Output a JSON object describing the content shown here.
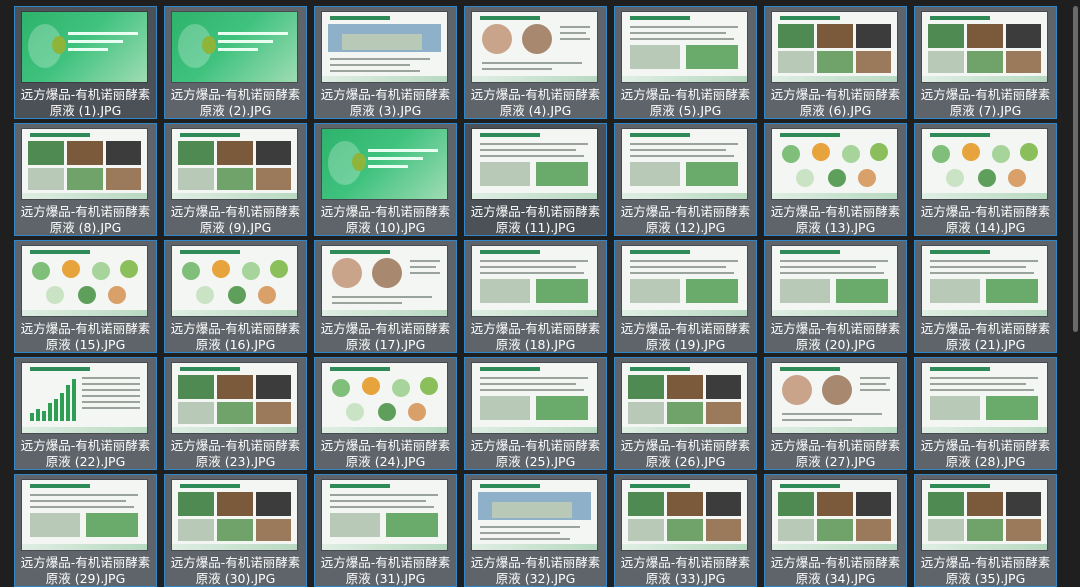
{
  "files": [
    {
      "name": "远方爆品-有机诺丽酵素\n原液 (1).JPG",
      "style": "green"
    },
    {
      "name": "远方爆品-有机诺丽酵素\n原液 (2).JPG",
      "style": "green"
    },
    {
      "name": "远方爆品-有机诺丽酵素\n原液 (3).JPG",
      "style": "building"
    },
    {
      "name": "远方爆品-有机诺丽酵素\n原液 (4).JPG",
      "style": "people"
    },
    {
      "name": "远方爆品-有机诺丽酵素\n原液 (5).JPG",
      "style": "text"
    },
    {
      "name": "远方爆品-有机诺丽酵素\n原液 (6).JPG",
      "style": "photos"
    },
    {
      "name": "远方爆品-有机诺丽酵素\n原液 (7).JPG",
      "style": "photos"
    },
    {
      "name": "远方爆品-有机诺丽酵素\n原液 (8).JPG",
      "style": "photos"
    },
    {
      "name": "远方爆品-有机诺丽酵素\n原液 (9).JPG",
      "style": "photos"
    },
    {
      "name": "远方爆品-有机诺丽酵素\n原液 (10).JPG",
      "style": "green"
    },
    {
      "name": "远方爆品-有机诺丽酵素\n原液 (11).JPG",
      "style": "text"
    },
    {
      "name": "远方爆品-有机诺丽酵素\n原液 (12).JPG",
      "style": "text"
    },
    {
      "name": "远方爆品-有机诺丽酵素\n原液 (13).JPG",
      "style": "circles"
    },
    {
      "name": "远方爆品-有机诺丽酵素\n原液 (14).JPG",
      "style": "circles"
    },
    {
      "name": "远方爆品-有机诺丽酵素\n原液 (15).JPG",
      "style": "circles"
    },
    {
      "name": "远方爆品-有机诺丽酵素\n原液 (16).JPG",
      "style": "circles"
    },
    {
      "name": "远方爆品-有机诺丽酵素\n原液 (17).JPG",
      "style": "people"
    },
    {
      "name": "远方爆品-有机诺丽酵素\n原液 (18).JPG",
      "style": "text"
    },
    {
      "name": "远方爆品-有机诺丽酵素\n原液 (19).JPG",
      "style": "text"
    },
    {
      "name": "远方爆品-有机诺丽酵素\n原液 (20).JPG",
      "style": "text"
    },
    {
      "name": "远方爆品-有机诺丽酵素\n原液 (21).JPG",
      "style": "text"
    },
    {
      "name": "远方爆品-有机诺丽酵素\n原液 (22).JPG",
      "style": "chart"
    },
    {
      "name": "远方爆品-有机诺丽酵素\n原液 (23).JPG",
      "style": "photos"
    },
    {
      "name": "远方爆品-有机诺丽酵素\n原液 (24).JPG",
      "style": "circles"
    },
    {
      "name": "远方爆品-有机诺丽酵素\n原液 (25).JPG",
      "style": "text"
    },
    {
      "name": "远方爆品-有机诺丽酵素\n原液 (26).JPG",
      "style": "photos"
    },
    {
      "name": "远方爆品-有机诺丽酵素\n原液 (27).JPG",
      "style": "people"
    },
    {
      "name": "远方爆品-有机诺丽酵素\n原液 (28).JPG",
      "style": "text"
    },
    {
      "name": "远方爆品-有机诺丽酵素\n原液 (29).JPG",
      "style": "text"
    },
    {
      "name": "远方爆品-有机诺丽酵素\n原液 (30).JPG",
      "style": "photos"
    },
    {
      "name": "远方爆品-有机诺丽酵素\n原液 (31).JPG",
      "style": "text"
    },
    {
      "name": "远方爆品-有机诺丽酵素\n原液 (32).JPG",
      "style": "building"
    },
    {
      "name": "远方爆品-有机诺丽酵素\n原液 (33).JPG",
      "style": "photos"
    },
    {
      "name": "远方爆品-有机诺丽酵素\n原液 (34).JPG",
      "style": "photos"
    },
    {
      "name": "远方爆品-有机诺丽酵素\n原液 (35).JPG",
      "style": "photos"
    }
  ],
  "colors": {
    "background": "#1f1f1f",
    "tile": "#5f646a",
    "tile_border": "#2f86c8",
    "label": "#ffffff",
    "accent_green": "#2db36b"
  }
}
